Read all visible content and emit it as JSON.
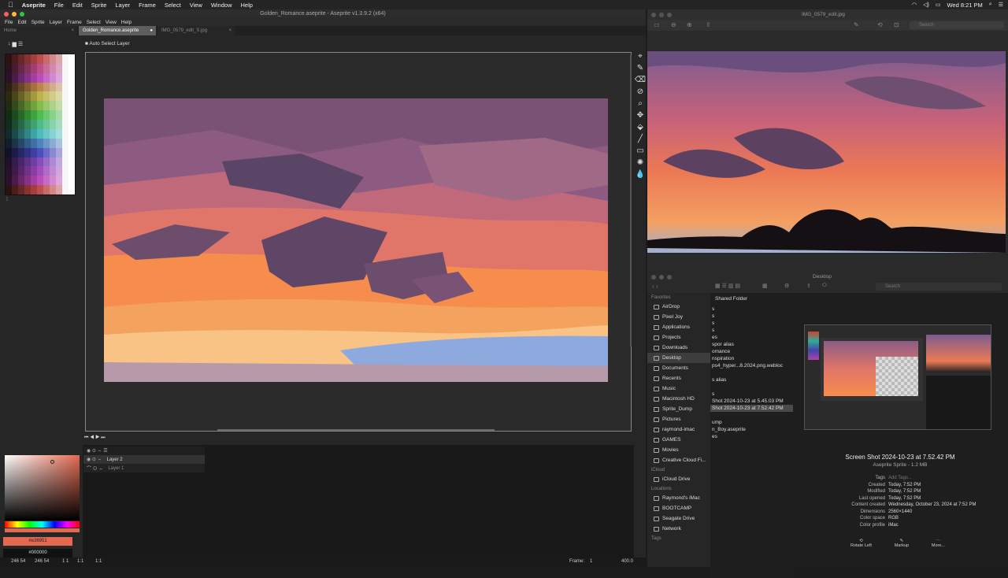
{
  "menubar": {
    "app": "Aseprite",
    "items": [
      "File",
      "Edit",
      "Sprite",
      "Layer",
      "Frame",
      "Select",
      "View",
      "Window",
      "Help"
    ],
    "clock": "Wed 8:21 PM"
  },
  "window": {
    "title": "Golden_Romance.aseprite - Aseprite v1.3.9.2 (x64)",
    "menu": [
      "File",
      "Edit",
      "Sprite",
      "Layer",
      "Frame",
      "Select",
      "View",
      "Help"
    ]
  },
  "tabs": {
    "home": "Home",
    "active": "Golden_Romance.aseprite",
    "other": "IMG_0579_edit_S.jpg"
  },
  "toolbar": {
    "auto_select": "Auto Select Layer"
  },
  "colors": {
    "fg": "#e36951",
    "bg": "#000000"
  },
  "layers": [
    {
      "name": "Layer 2"
    },
    {
      "name": "Layer 1"
    }
  ],
  "status": {
    "coords": "246 54",
    "size": "246 54",
    "extra": "1 1",
    "ratio": "1:1",
    "ratio2": "1:1",
    "frame_label": "Frame:",
    "frame": "1",
    "zoom": "400.0"
  },
  "preview": {
    "title": "IMG_0579_edit.jpg",
    "search": "Search"
  },
  "finder": {
    "title": "Desktop",
    "search": "Search",
    "path_header": "Shared Folder",
    "favorites_label": "Favorites",
    "favorites": [
      "AirDrop",
      "Pixel Joy",
      "Applications",
      "Projects",
      "Downloads",
      "Desktop",
      "Documents",
      "Recents",
      "Music",
      "Macintosh HD",
      "Sprite_Dump",
      "Pictures",
      "raymond-imac",
      "GAMES",
      "Movies",
      "Creative Cloud Fi..."
    ],
    "icloud_label": "iCloud",
    "icloud": [
      "iCloud Drive"
    ],
    "locations_label": "Locations",
    "locations": [
      "Raymond's iMac",
      "BOOTCAMP",
      "Seagate Drive",
      "Network"
    ],
    "tags_label": "Tags",
    "files": [
      "s",
      "s",
      "s",
      "s",
      "es",
      "spor alias",
      "omance",
      "nspiration",
      "ps4_hyper...8.2024.png.webloc",
      "",
      "s alias",
      "",
      "s",
      "Shot 2024-10-23 at 5.45.03 PM",
      "Shot 2024-10-23 at 7.52.42 PM",
      "",
      "ump",
      "n_Boy.aseprite",
      "es"
    ],
    "preview_name": "Screen Shot 2024-10-23 at 7.52.42 PM",
    "preview_kind": "Aseprite Sprite - 1.2 MB",
    "info": [
      [
        "Tags",
        "Add Tags..."
      ],
      [
        "Created",
        "Today, 7:52 PM"
      ],
      [
        "Modified",
        "Today, 7:52 PM"
      ],
      [
        "Last opened",
        "Today, 7:52 PM"
      ],
      [
        "Content created",
        "Wednesday, October 23, 2024 at 7:52 PM"
      ],
      [
        "Dimensions",
        "2560×1440"
      ],
      [
        "Color space",
        "RGB"
      ],
      [
        "Color profile",
        "iMac"
      ]
    ],
    "actions": [
      "Rotate Left",
      "Markup",
      "More..."
    ]
  }
}
